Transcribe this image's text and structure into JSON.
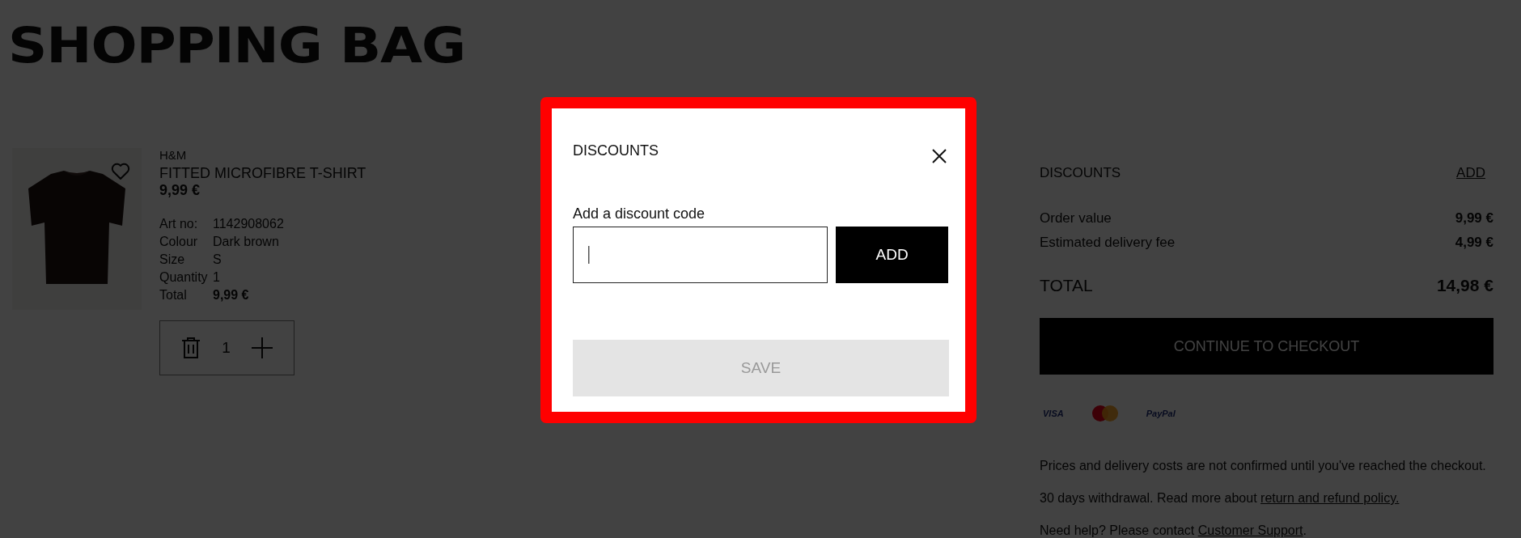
{
  "page": {
    "title": "SHOPPING BAG"
  },
  "cart_items": [
    {
      "brand": "H&M",
      "name": "FITTED MICROFIBRE T-SHIRT",
      "price": "9,99 €",
      "favorite": false,
      "quantity": "1",
      "details": [
        {
          "label": "Art no:",
          "value": "1142908062",
          "bold": false
        },
        {
          "label": "Colour",
          "value": "Dark brown",
          "bold": false
        },
        {
          "label": "Size",
          "value": "S",
          "bold": false
        },
        {
          "label": "Quantity",
          "value": "1",
          "bold": false
        },
        {
          "label": "Total",
          "value": "9,99 €",
          "bold": true
        }
      ]
    }
  ],
  "summary": {
    "discounts_label": "DISCOUNTS",
    "discounts_action": "ADD",
    "rows": [
      {
        "label": "Order value",
        "value": "9,99 €"
      },
      {
        "label": "Estimated delivery fee",
        "value": "4,99 €"
      }
    ],
    "total": {
      "label": "TOTAL",
      "value": "14,98 €"
    },
    "checkout_button": "CONTINUE TO CHECKOUT",
    "payment_methods": [
      {
        "kind": "wordmark",
        "label": "VISA"
      },
      {
        "kind": "circles"
      },
      {
        "kind": "wordmark",
        "label": "PayPal"
      }
    ],
    "notes": [
      {
        "text": "Prices and delivery costs are not confirmed until you've reached the checkout."
      },
      {
        "text": "30 days withdrawal. Read more about ",
        "link": "return and refund policy."
      },
      {
        "text": "Need help? Please contact ",
        "link": "Customer Support",
        "after": "."
      }
    ]
  },
  "modal": {
    "title": "DISCOUNTS",
    "field_label": "Add a discount code",
    "add_button": "ADD",
    "save_button": {
      "label": "SAVE",
      "disabled": true
    }
  }
}
